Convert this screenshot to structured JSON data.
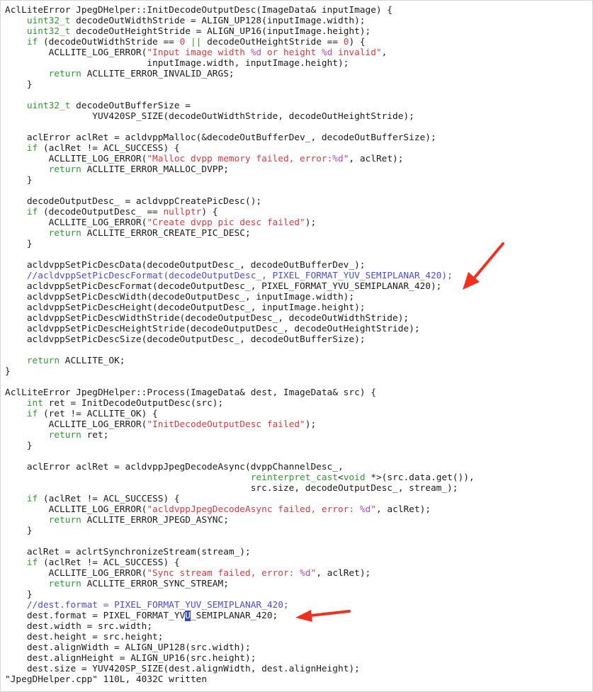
{
  "editor": {
    "file_name": "JpegDHelper.cpp",
    "status_line": "\"JpegDHelper.cpp\" 110L, 4032C written",
    "colors": {
      "background": "#ffffff",
      "text": "#1a1a1a",
      "type": "#2a9c2a",
      "keyword": "#2a9c2a",
      "number": "#e0383c",
      "string": "#e0383c",
      "format_spec": "#b44cbf",
      "comment": "#4a4ae0",
      "arrow": "#f03020"
    },
    "lines": [
      [
        [
          "plain",
          "AclLiteError JpegDHelper::InitDecodeOutputDesc(ImageData& inputImage) {"
        ]
      ],
      [
        [
          "plain",
          "    "
        ],
        [
          "type",
          "uint32_t"
        ],
        [
          "plain",
          " decodeOutWidthStride = ALIGN_UP128(inputImage.width);"
        ]
      ],
      [
        [
          "plain",
          "    "
        ],
        [
          "type",
          "uint32_t"
        ],
        [
          "plain",
          " decodeOutHeightStride = ALIGN_UP16(inputImage.height);"
        ]
      ],
      [
        [
          "plain",
          "    "
        ],
        [
          "kw",
          "if"
        ],
        [
          "plain",
          " (decodeOutWidthStride == "
        ],
        [
          "num",
          "0"
        ],
        [
          "plain",
          " "
        ],
        [
          "kw",
          "||"
        ],
        [
          "plain",
          " decodeOutHeightStride == "
        ],
        [
          "num",
          "0"
        ],
        [
          "plain",
          ") {"
        ]
      ],
      [
        [
          "plain",
          "        ACLLITE_LOG_ERROR("
        ],
        [
          "str",
          "\"Input image width "
        ],
        [
          "fmt",
          "%d"
        ],
        [
          "str",
          " or height "
        ],
        [
          "fmt",
          "%d"
        ],
        [
          "str",
          " invalid\""
        ],
        [
          "plain",
          ","
        ]
      ],
      [
        [
          "plain",
          "                          inputImage.width, inputImage.height);"
        ]
      ],
      [
        [
          "plain",
          "        "
        ],
        [
          "kw",
          "return"
        ],
        [
          "plain",
          " ACLLITE_ERROR_INVALID_ARGS;"
        ]
      ],
      [
        [
          "plain",
          "    }"
        ]
      ],
      [],
      [
        [
          "plain",
          "    "
        ],
        [
          "type",
          "uint32_t"
        ],
        [
          "plain",
          " decodeOutBufferSize ="
        ]
      ],
      [
        [
          "plain",
          "                YUV420SP_SIZE(decodeOutWidthStride, decodeOutHeightStride);"
        ]
      ],
      [],
      [
        [
          "plain",
          "    aclError aclRet = acldvppMalloc(&decodeOutBufferDev_, decodeOutBufferSize);"
        ]
      ],
      [
        [
          "plain",
          "    "
        ],
        [
          "kw",
          "if"
        ],
        [
          "plain",
          " (aclRet != ACL_SUCCESS) {"
        ]
      ],
      [
        [
          "plain",
          "        ACLLITE_LOG_ERROR("
        ],
        [
          "str",
          "\"Malloc dvpp memory failed, error:"
        ],
        [
          "fmt",
          "%d"
        ],
        [
          "str",
          "\""
        ],
        [
          "plain",
          ", aclRet);"
        ]
      ],
      [
        [
          "plain",
          "        "
        ],
        [
          "kw",
          "return"
        ],
        [
          "plain",
          " ACLLITE_ERROR_MALLOC_DVPP;"
        ]
      ],
      [
        [
          "plain",
          "    }"
        ]
      ],
      [],
      [
        [
          "plain",
          "    decodeOutputDesc_ = acldvppCreatePicDesc();"
        ]
      ],
      [
        [
          "plain",
          "    "
        ],
        [
          "kw",
          "if"
        ],
        [
          "plain",
          " (decodeOutputDesc_ == "
        ],
        [
          "num",
          "nullptr"
        ],
        [
          "plain",
          ") {"
        ]
      ],
      [
        [
          "plain",
          "        ACLLITE_LOG_ERROR("
        ],
        [
          "str",
          "\"Create dvpp pic desc failed\""
        ],
        [
          "plain",
          ");"
        ]
      ],
      [
        [
          "plain",
          "        "
        ],
        [
          "kw",
          "return"
        ],
        [
          "plain",
          " ACLLITE_ERROR_CREATE_PIC_DESC;"
        ]
      ],
      [
        [
          "plain",
          "    }"
        ]
      ],
      [],
      [
        [
          "plain",
          "    acldvppSetPicDescData(decodeOutputDesc_, decodeOutBufferDev_);"
        ]
      ],
      [
        [
          "plain",
          "    "
        ],
        [
          "cmt",
          "//acldvppSetPicDescFormat(decodeOutputDesc_, PIXEL_FORMAT_YUV_SEMIPLANAR_420);"
        ]
      ],
      [
        [
          "plain",
          "    acldvppSetPicDescFormat(decodeOutputDesc_, PIXEL_FORMAT_YVU_SEMIPLANAR_420);"
        ]
      ],
      [
        [
          "plain",
          "    acldvppSetPicDescWidth(decodeOutputDesc_, inputImage.width);"
        ]
      ],
      [
        [
          "plain",
          "    acldvppSetPicDescHeight(decodeOutputDesc_, inputImage.height);"
        ]
      ],
      [
        [
          "plain",
          "    acldvppSetPicDescWidthStride(decodeOutputDesc_, decodeOutWidthStride);"
        ]
      ],
      [
        [
          "plain",
          "    acldvppSetPicDescHeightStride(decodeOutputDesc_, decodeOutHeightStride);"
        ]
      ],
      [
        [
          "plain",
          "    acldvppSetPicDescSize(decodeOutputDesc_, decodeOutBufferSize);"
        ]
      ],
      [],
      [
        [
          "plain",
          "    "
        ],
        [
          "kw",
          "return"
        ],
        [
          "plain",
          " ACLLITE_OK;"
        ]
      ],
      [
        [
          "plain",
          "}"
        ]
      ],
      [],
      [
        [
          "plain",
          "AclLiteError JpegDHelper::Process(ImageData& dest, ImageData& src) {"
        ]
      ],
      [
        [
          "plain",
          "    "
        ],
        [
          "type",
          "int"
        ],
        [
          "plain",
          " ret = InitDecodeOutputDesc(src);"
        ]
      ],
      [
        [
          "plain",
          "    "
        ],
        [
          "kw",
          "if"
        ],
        [
          "plain",
          " (ret != ACLLITE_OK) {"
        ]
      ],
      [
        [
          "plain",
          "        ACLLITE_LOG_ERROR("
        ],
        [
          "str",
          "\"InitDecodeOutputDesc failed\""
        ],
        [
          "plain",
          ");"
        ]
      ],
      [
        [
          "plain",
          "        "
        ],
        [
          "kw",
          "return"
        ],
        [
          "plain",
          " ret;"
        ]
      ],
      [
        [
          "plain",
          "    }"
        ]
      ],
      [],
      [
        [
          "plain",
          "    aclError aclRet = acldvppJpegDecodeAsync(dvppChannelDesc_,"
        ]
      ],
      [
        [
          "plain",
          "                                             "
        ],
        [
          "kw",
          "reinterpret_cast"
        ],
        [
          "plain",
          "<"
        ],
        [
          "type",
          "void"
        ],
        [
          "plain",
          " *>(src.data.get()),"
        ]
      ],
      [
        [
          "plain",
          "                                             src.size, decodeOutputDesc_, stream_);"
        ]
      ],
      [
        [
          "plain",
          "    "
        ],
        [
          "kw",
          "if"
        ],
        [
          "plain",
          " (aclRet != ACL_SUCCESS) {"
        ]
      ],
      [
        [
          "plain",
          "        ACLLITE_LOG_ERROR("
        ],
        [
          "str",
          "\"acldvppJpegDecodeAsync failed, error: "
        ],
        [
          "fmt",
          "%d"
        ],
        [
          "str",
          "\""
        ],
        [
          "plain",
          ", aclRet);"
        ]
      ],
      [
        [
          "plain",
          "        "
        ],
        [
          "kw",
          "return"
        ],
        [
          "plain",
          " ACLLITE_ERROR_JPEGD_ASYNC;"
        ]
      ],
      [
        [
          "plain",
          "    }"
        ]
      ],
      [],
      [
        [
          "plain",
          "    aclRet = aclrtSynchronizeStream(stream_);"
        ]
      ],
      [
        [
          "plain",
          "    "
        ],
        [
          "kw",
          "if"
        ],
        [
          "plain",
          " (aclRet != ACL_SUCCESS) {"
        ]
      ],
      [
        [
          "plain",
          "        ACLLITE_LOG_ERROR("
        ],
        [
          "str",
          "\"Sync stream failed, error: "
        ],
        [
          "fmt",
          "%d"
        ],
        [
          "str",
          "\""
        ],
        [
          "plain",
          ", aclRet);"
        ]
      ],
      [
        [
          "plain",
          "        "
        ],
        [
          "kw",
          "return"
        ],
        [
          "plain",
          " ACLLITE_ERROR_SYNC_STREAM;"
        ]
      ],
      [
        [
          "plain",
          "    }"
        ]
      ],
      [
        [
          "plain",
          "    "
        ],
        [
          "cmt",
          "//dest.format = PIXEL_FORMAT_YUV_SEMIPLANAR_420;"
        ]
      ],
      [
        [
          "plain",
          "    dest.format = PIXEL_FORMAT_YV"
        ],
        [
          "cursor",
          "U"
        ],
        [
          "plain",
          "_SEMIPLANAR_420;"
        ]
      ],
      [
        [
          "plain",
          "    dest.width = src.width;"
        ]
      ],
      [
        [
          "plain",
          "    dest.height = src.height;"
        ]
      ],
      [
        [
          "plain",
          "    dest.alignWidth = ALIGN_UP128(src.width);"
        ]
      ],
      [
        [
          "plain",
          "    dest.alignHeight = ALIGN_UP16(src.height);"
        ]
      ],
      [
        [
          "plain",
          "    dest.size = YUV420SP_SIZE(dest.alignWidth, dest.alignHeight);"
        ]
      ]
    ]
  }
}
